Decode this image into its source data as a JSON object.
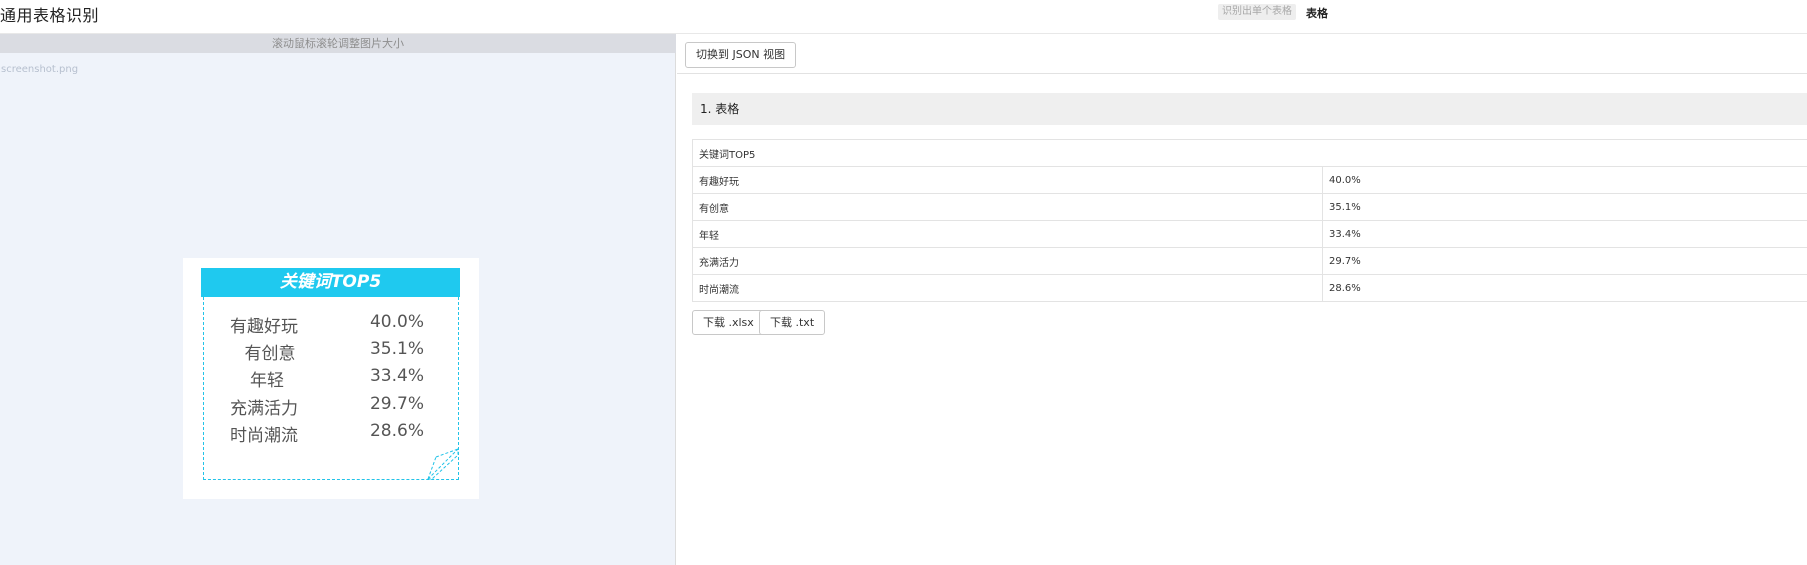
{
  "header": {
    "title": "通用表格识别",
    "hint_badge": "识别出单个表格",
    "mode_label": "表格"
  },
  "left": {
    "zoom_hint": "滚动鼠标滚轮调整图片大小",
    "filename": "screenshot.png",
    "preview": {
      "title": "关键词TOP5",
      "rows": [
        {
          "key": "有趣好玩",
          "value": "40.0%"
        },
        {
          "key": "有创意",
          "value": "35.1%"
        },
        {
          "key": "年轻",
          "value": "33.4%"
        },
        {
          "key": "充满活力",
          "value": "29.7%"
        },
        {
          "key": "时尚潮流",
          "value": "28.6%"
        }
      ]
    }
  },
  "right": {
    "toggle_json_label": "切换到 JSON 视图",
    "section_title": "1. 表格",
    "table": {
      "caption_row": "关键词TOP5",
      "rows": [
        [
          "有趣好玩",
          "40.0%"
        ],
        [
          "有创意",
          "35.1%"
        ],
        [
          "年轻",
          "33.4%"
        ],
        [
          "充满活力",
          "29.7%"
        ],
        [
          "时尚潮流",
          "28.6%"
        ]
      ]
    },
    "download_xlsx_label": "下载 .xlsx",
    "download_txt_label": "下载 .txt"
  },
  "colors": {
    "preview_header": "#1fc9ef",
    "left_bg": "#eff3fa",
    "section_bg": "#efefef"
  }
}
